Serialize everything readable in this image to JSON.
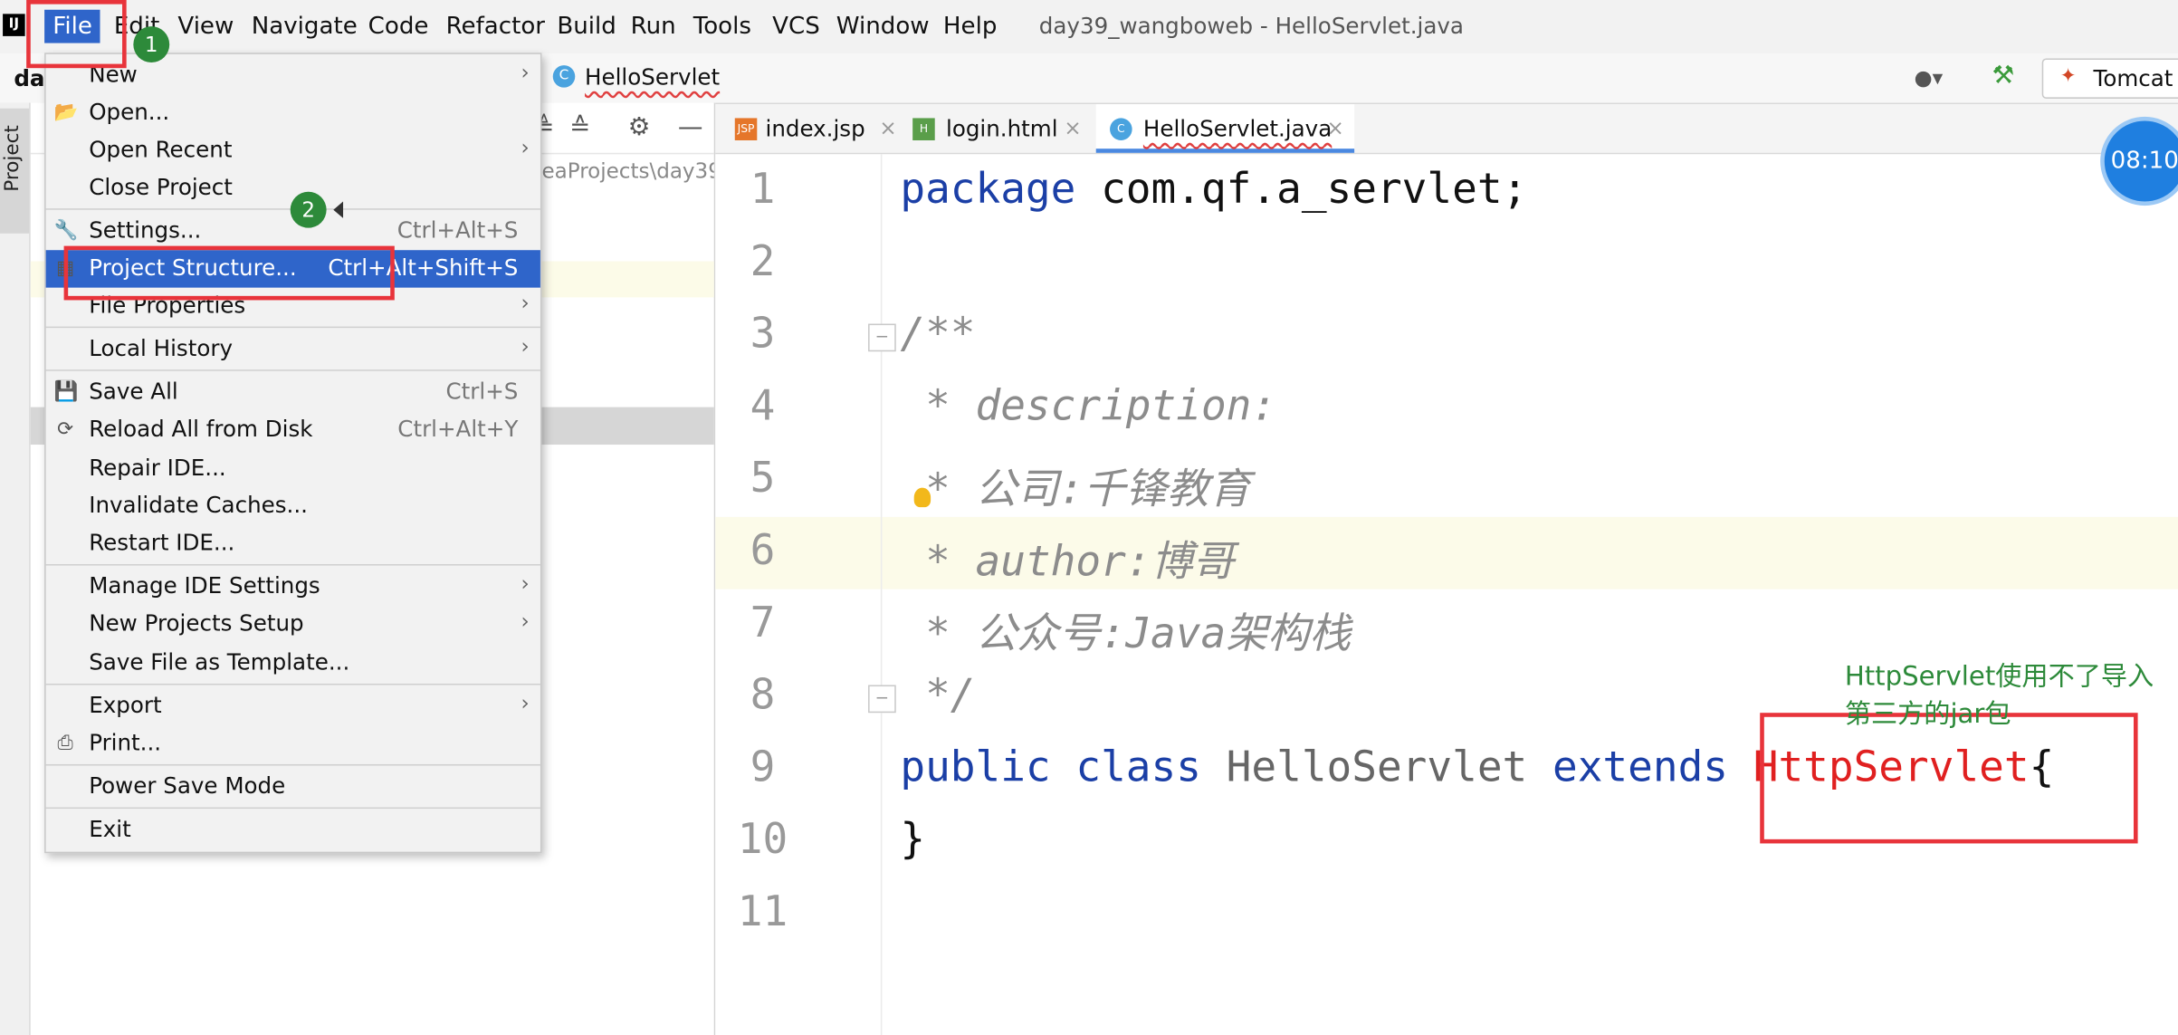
{
  "menubar": {
    "logo": "IJ",
    "items": [
      "File",
      "Edit",
      "View",
      "Navigate",
      "Code",
      "Refactor",
      "Build",
      "Run",
      "Tools",
      "VCS",
      "Window",
      "Help"
    ],
    "window_title": "day39_wangboweb - HelloServlet.java"
  },
  "navbar": {
    "project": "day",
    "class_icon": "C",
    "class_name": "HelloServlet",
    "user_icon": "user-icon",
    "build_icon": "hammer-icon",
    "run_config": "Tomcat"
  },
  "tool_strip": {
    "project_tab": "Project"
  },
  "project_panel": {
    "path_fragment": "eaProjects\\day39"
  },
  "tabs": [
    {
      "icon": "JSP",
      "label": "index.jsp",
      "active": false
    },
    {
      "icon": "H",
      "label": "login.html",
      "active": false
    },
    {
      "icon": "C",
      "label": "HelloServlet.java",
      "active": true
    }
  ],
  "editor": {
    "line_numbers": [
      "1",
      "2",
      "3",
      "4",
      "5",
      "6",
      "7",
      "8",
      "9",
      "10",
      "11"
    ],
    "l1_kw": "package",
    "l1_rest": " com.qf.a_servlet;",
    "l3": "/**",
    "l4": " * description:",
    "l5": " * 公司:千锋教育",
    "l6": " * author:博哥",
    "l7": " * 公众号:Java架构栈",
    "l8": " */",
    "l9_kw1": "public",
    "l9_kw2": "class",
    "l9_cls": "HelloServlet",
    "l9_kw3": "extends",
    "l9_err": "HttpServlet",
    "l9_brace": "{",
    "l10": "}"
  },
  "timer": "08:10",
  "file_menu": {
    "items": [
      {
        "label": "New",
        "shortcut": "",
        "submenu": true,
        "icon": ""
      },
      {
        "label": "Open...",
        "shortcut": "",
        "submenu": false,
        "icon": "folder-icon"
      },
      {
        "label": "Open Recent",
        "shortcut": "",
        "submenu": true,
        "icon": ""
      },
      {
        "label": "Close Project",
        "shortcut": "",
        "submenu": false,
        "icon": ""
      },
      {
        "label": "Settings...",
        "shortcut": "Ctrl+Alt+S",
        "submenu": false,
        "icon": "wrench-icon"
      },
      {
        "label": "Project Structure...",
        "shortcut": "Ctrl+Alt+Shift+S",
        "submenu": false,
        "icon": "project-structure-icon"
      },
      {
        "label": "File Properties",
        "shortcut": "",
        "submenu": true,
        "icon": ""
      },
      {
        "label": "Local History",
        "shortcut": "",
        "submenu": true,
        "icon": ""
      },
      {
        "label": "Save All",
        "shortcut": "Ctrl+S",
        "submenu": false,
        "icon": "save-icon"
      },
      {
        "label": "Reload All from Disk",
        "shortcut": "Ctrl+Alt+Y",
        "submenu": false,
        "icon": "reload-icon"
      },
      {
        "label": "Repair IDE...",
        "shortcut": "",
        "submenu": false,
        "icon": ""
      },
      {
        "label": "Invalidate Caches...",
        "shortcut": "",
        "submenu": false,
        "icon": ""
      },
      {
        "label": "Restart IDE...",
        "shortcut": "",
        "submenu": false,
        "icon": ""
      },
      {
        "label": "Manage IDE Settings",
        "shortcut": "",
        "submenu": true,
        "icon": ""
      },
      {
        "label": "New Projects Setup",
        "shortcut": "",
        "submenu": true,
        "icon": ""
      },
      {
        "label": "Save File as Template...",
        "shortcut": "",
        "submenu": false,
        "icon": ""
      },
      {
        "label": "Export",
        "shortcut": "",
        "submenu": true,
        "icon": ""
      },
      {
        "label": "Print...",
        "shortcut": "",
        "submenu": false,
        "icon": "print-icon"
      },
      {
        "label": "Power Save Mode",
        "shortcut": "",
        "submenu": false,
        "icon": ""
      },
      {
        "label": "Exit",
        "shortcut": "",
        "submenu": false,
        "icon": ""
      }
    ]
  },
  "annotations": {
    "step1": "1",
    "step2": "2",
    "note": "HttpServlet使用不了导入第三方的jar包"
  }
}
